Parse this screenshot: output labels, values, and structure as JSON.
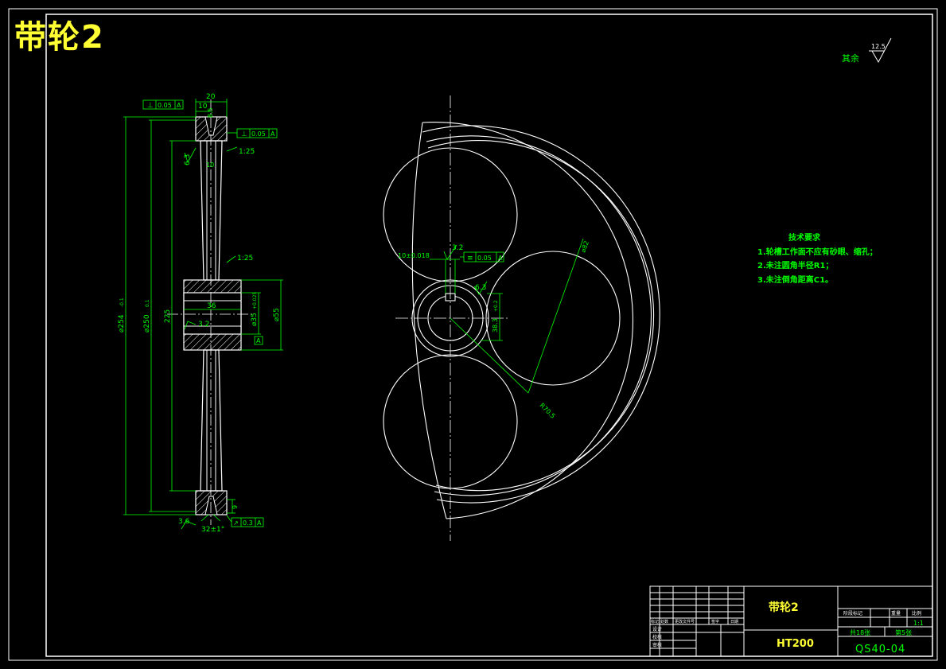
{
  "page_title": "带轮2",
  "roughness_other": {
    "label": "其余",
    "value": "12.5"
  },
  "section_view": {
    "dims": {
      "width_20": "20",
      "width_10": "10",
      "groove_8_5": "8.5",
      "groove_10": "10",
      "d254": "⌀254",
      "d254_tol": "-0.1",
      "d250": "⌀250",
      "d250_tol": "0.1",
      "h225": "225",
      "hub36": "36",
      "d35": "⌀35",
      "d35_tol": "+0.025",
      "d55": "⌀55",
      "r32": "3.2",
      "r63": "6.3",
      "r36_bottom": "3.6",
      "slope1": "1:25",
      "slope2": "1:25",
      "angle": "32±1°",
      "dim9": "9",
      "datum": "A"
    },
    "tolerances": [
      {
        "symbol": "⊥",
        "value": "0.05",
        "datum": "A"
      },
      {
        "symbol": "⊥",
        "value": "0.05",
        "datum": "A"
      },
      {
        "symbol": "↗",
        "value": "0.3",
        "datum": "A"
      }
    ]
  },
  "front_view": {
    "dims": {
      "r_top": "3.2",
      "keyway": "10±0.018",
      "r_hub": "6.3",
      "d38": "38.3",
      "d_key": "+0.2",
      "hole_d": "⌀82",
      "radius": "R70.5"
    },
    "tolerance": {
      "symbol": "≡",
      "value": "0.05",
      "datum": "A"
    }
  },
  "tech_requirements": {
    "title": "技术要求",
    "items": [
      "1.轮槽工作面不应有砂眼、缩孔；",
      "2.未注圆角半径R1；",
      "3.未注倒角距离C1。"
    ]
  },
  "title_block": {
    "part_name": "带轮2",
    "material": "HT200",
    "drawing_no": "QS40-04",
    "header_cells": [
      "标记",
      "处数",
      "更改文件号",
      "签字",
      "日期"
    ],
    "roles": [
      "设计",
      "校核",
      "审核"
    ],
    "stage_labels": [
      "阶段标记",
      "重量",
      "比例"
    ],
    "scale": "1:1",
    "sheets": "共18张",
    "sheet_no": "第5张"
  },
  "colors": {
    "background": "#000000",
    "geometry": "#ffffff",
    "dimension": "#00ff00",
    "title": "#ffff33"
  }
}
